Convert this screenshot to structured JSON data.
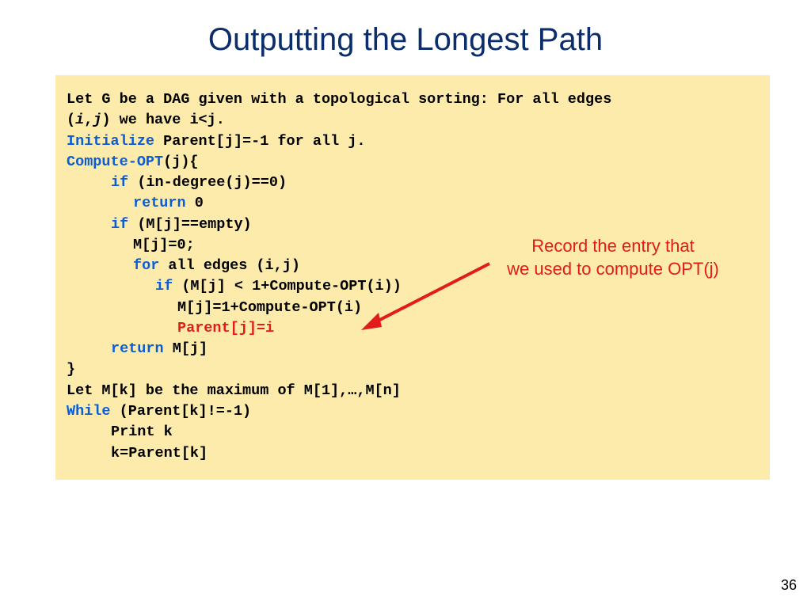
{
  "title": "Outputting the Longest Path",
  "code": {
    "l1a": "Let G be a DAG given with a topological sorting: For all edges",
    "l2a": "(",
    "l2b": "i",
    "l2c": ",",
    "l2d": "j",
    "l2e": ") we have i<j.",
    "l3a": "Initialize",
    "l3b": " Parent[j]=-1 for all j.",
    "l4a": "Compute-OPT",
    "l4b": "(j){",
    "l5a": "if",
    "l5b": " (in-degree(j)==0)",
    "l6a": "return",
    "l6b": " 0",
    "l7a": "if",
    "l7b": " (M[j]==empty)",
    "l8": "M[j]=0;",
    "l9a": "for",
    "l9b": " all edges (i,j)",
    "l10a": "if",
    "l10b": " (M[j] < 1+Compute-OPT(i))",
    "l11": "M[j]=1+Compute-OPT(i)",
    "l12": "Parent[j]=i",
    "l13a": "return",
    "l13b": " M[j]",
    "l14": "}",
    "l15": "Let M[k] be the maximum of M[1],…,M[n]",
    "l16a": "While",
    "l16b": " (Parent[k]!=-1)",
    "l17": "Print k",
    "l18": "k=Parent[k]"
  },
  "annotation": {
    "line1": "Record the entry that",
    "line2": "we used to compute OPT(j)"
  },
  "page_number": "36"
}
